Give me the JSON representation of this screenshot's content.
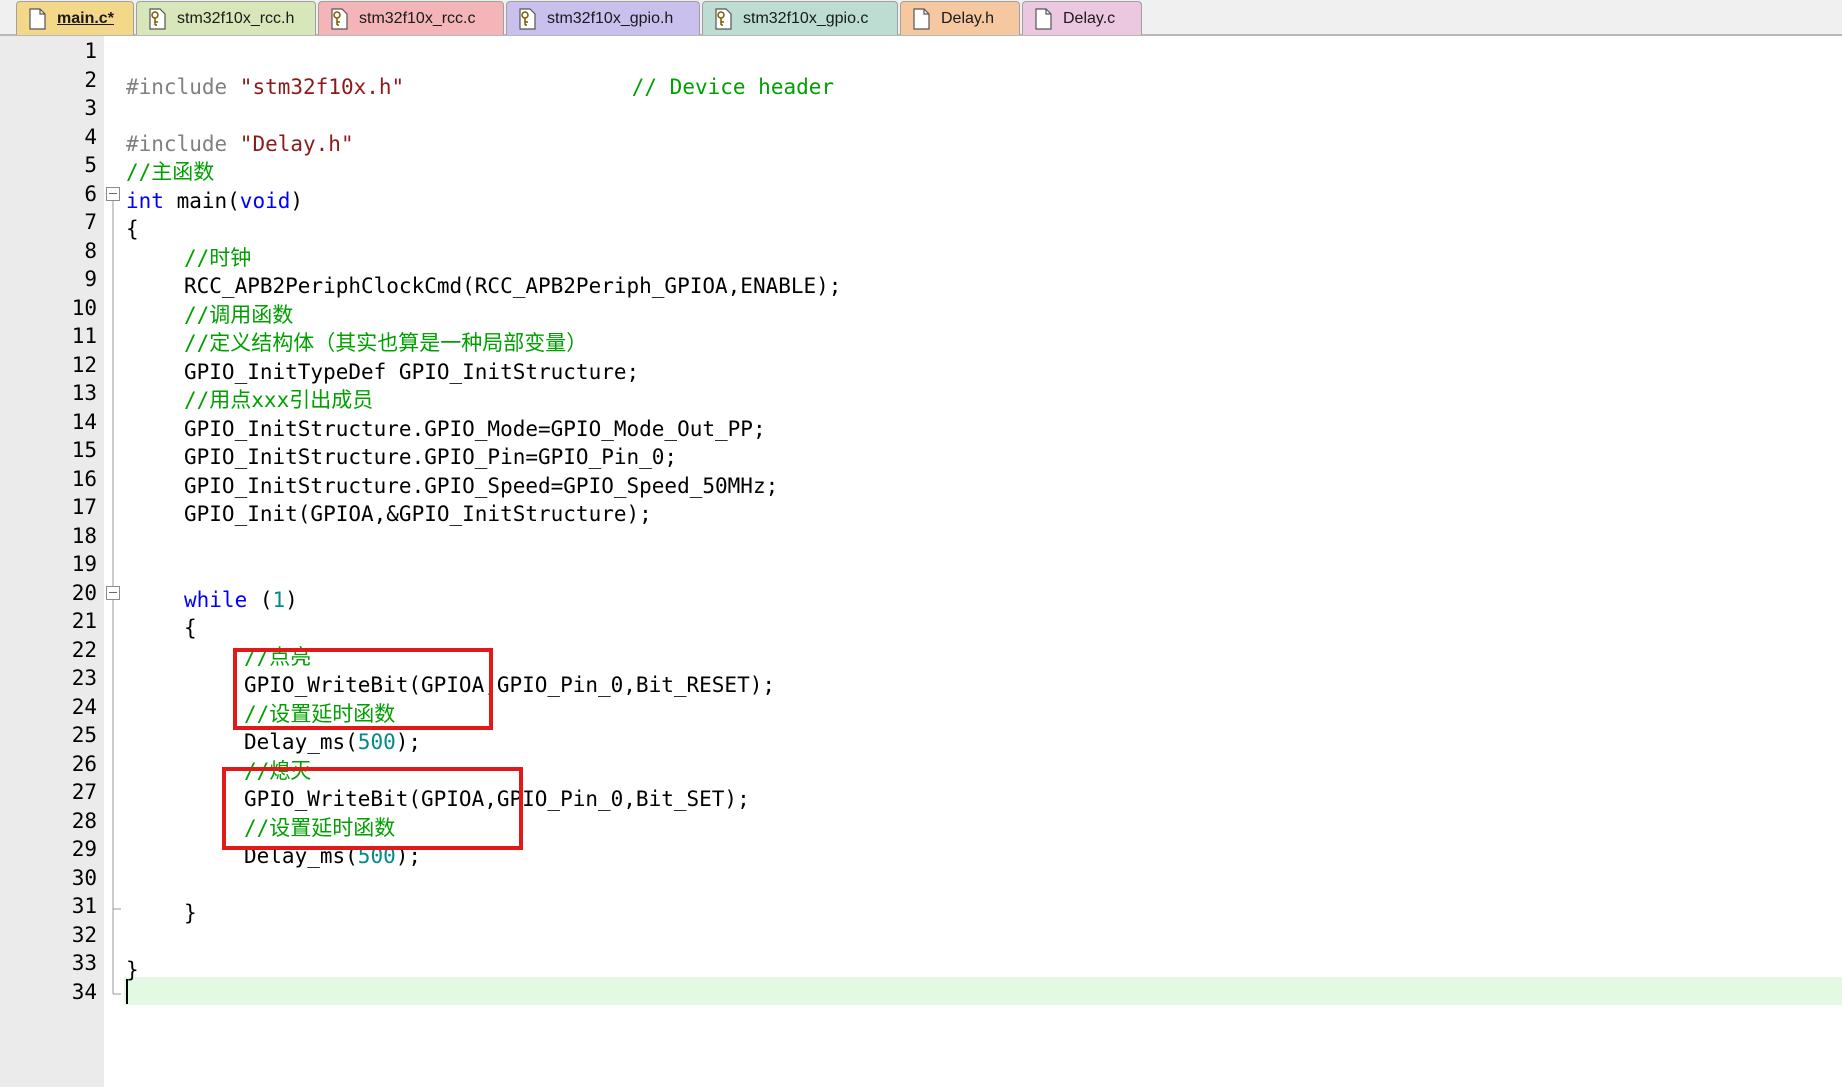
{
  "tabs": [
    {
      "label": "main.c*",
      "active": true,
      "bg": "#f3d88a",
      "icon": "document-icon"
    },
    {
      "label": "stm32f10x_rcc.h",
      "active": false,
      "bg": "#d7e7b9",
      "icon": "key-document-icon"
    },
    {
      "label": "stm32f10x_rcc.c",
      "active": false,
      "bg": "#f4b5b9",
      "icon": "key-document-icon"
    },
    {
      "label": "stm32f10x_gpio.h",
      "active": false,
      "bg": "#c9c0ee",
      "icon": "key-document-icon"
    },
    {
      "label": "stm32f10x_gpio.c",
      "active": false,
      "bg": "#bddcd2",
      "icon": "key-document-icon"
    },
    {
      "label": "Delay.h",
      "active": false,
      "bg": "#f6c8a0",
      "icon": "document-icon"
    },
    {
      "label": "Delay.c",
      "active": false,
      "bg": "#ecc7e0",
      "icon": "document-icon"
    }
  ],
  "editor": {
    "line_numbers": [
      "1",
      "2",
      "3",
      "4",
      "5",
      "6",
      "7",
      "8",
      "9",
      "10",
      "11",
      "12",
      "13",
      "14",
      "15",
      "16",
      "17",
      "18",
      "19",
      "20",
      "21",
      "22",
      "23",
      "24",
      "25",
      "26",
      "27",
      "28",
      "29",
      "30",
      "31",
      "32",
      "33",
      "34"
    ],
    "current_line": "34",
    "colors": {
      "comment": "#00a000",
      "keyword": "#0000ff",
      "preprocessor": "#808080",
      "string": "#8b1a1a",
      "number": "#008b8b",
      "current_line_bg": "#e2f9e4",
      "annotation": "#e11919"
    },
    "code": {
      "l1": {
        "pp": "#include ",
        "str": "\"stm32f10x.h\"",
        "pad": "                  ",
        "cm": "// Device header"
      },
      "l3": {
        "pp": "#include ",
        "str": "\"Delay.h\""
      },
      "l4": {
        "cm": "//主函数"
      },
      "l5": {
        "kw1": "int",
        "t1": " main(",
        "kw2": "void",
        "t2": ")"
      },
      "l6": {
        "t": "{"
      },
      "l7": {
        "cm": "//时钟"
      },
      "l8": {
        "t": "RCC_APB2PeriphClockCmd(RCC_APB2Periph_GPIOA,ENABLE);"
      },
      "l9": {
        "cm": "//调用函数"
      },
      "l10": {
        "cm": "//定义结构体（其实也算是一种局部变量）"
      },
      "l11": {
        "t": "GPIO_InitTypeDef GPIO_InitStructure;"
      },
      "l12": {
        "cm": "//用点xxx引出成员"
      },
      "l13": {
        "t": "GPIO_InitStructure.GPIO_Mode=GPIO_Mode_Out_PP;"
      },
      "l14": {
        "t": "GPIO_InitStructure.GPIO_Pin=GPIO_Pin_0;"
      },
      "l15": {
        "t": "GPIO_InitStructure.GPIO_Speed=GPIO_Speed_50MHz;"
      },
      "l16": {
        "t": "GPIO_Init(GPIOA,&GPIO_InitStructure);"
      },
      "l19": {
        "kw": "while",
        "t1": " (",
        "num": "1",
        "t2": ")"
      },
      "l20": {
        "t": "{"
      },
      "l21": {
        "cm": "//点亮"
      },
      "l22": {
        "t": "GPIO_WriteBit(GPIOA,GPIO_Pin_0,Bit_RESET);"
      },
      "l23": {
        "cm": "//设置延时函数"
      },
      "l24": {
        "t1": "Delay_ms(",
        "num": "500",
        "t2": ");"
      },
      "l25": {
        "cm": "//熄灭"
      },
      "l26": {
        "t": "GPIO_WriteBit(GPIOA,GPIO_Pin_0,Bit_SET);"
      },
      "l27": {
        "cm": "//设置延时函数"
      },
      "l28": {
        "t1": "Delay_ms(",
        "num": "500",
        "t2": ");"
      },
      "l30": {
        "t": "}"
      },
      "l32": {
        "t": "}"
      }
    }
  }
}
